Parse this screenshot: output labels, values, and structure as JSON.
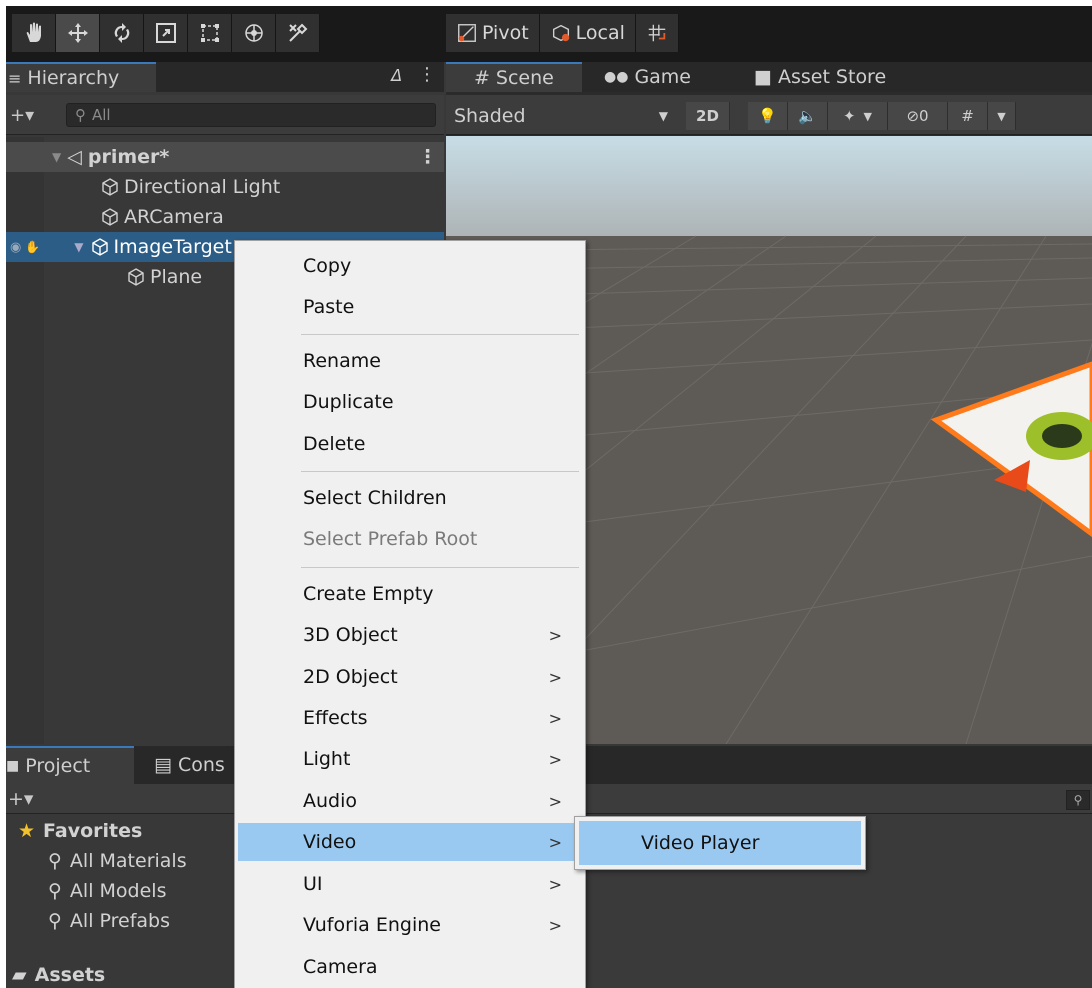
{
  "toolbar": {
    "tools": [
      "hand-tool",
      "move-tool",
      "rotate-tool",
      "scale-tool",
      "rect-tool",
      "transform-tool",
      "custom-tool"
    ],
    "pivot_label": "Pivot",
    "local_label": "Local"
  },
  "hierarchy": {
    "tab_label": "Hierarchy",
    "search_placeholder": "All",
    "items": [
      {
        "label": "primer*"
      },
      {
        "label": "Directional Light"
      },
      {
        "label": "ARCamera"
      },
      {
        "label": "ImageTarget"
      },
      {
        "label": "Plane"
      }
    ]
  },
  "scene": {
    "tabs": [
      {
        "label": "Scene"
      },
      {
        "label": "Game"
      },
      {
        "label": "Asset Store"
      }
    ],
    "shading_mode": "Shaded",
    "mode_2d": "2D",
    "hidden_count": "0"
  },
  "project": {
    "tabs": [
      {
        "label": "Project"
      },
      {
        "label": "Cons"
      }
    ],
    "favorites_label": "Favorites",
    "favorites": [
      {
        "label": "All Materials"
      },
      {
        "label": "All Models"
      },
      {
        "label": "All Prefabs"
      }
    ],
    "assets_label": "Assets"
  },
  "context_menu": {
    "items": [
      {
        "label": "Copy"
      },
      {
        "label": "Paste"
      },
      {
        "label": "Rename"
      },
      {
        "label": "Duplicate"
      },
      {
        "label": "Delete"
      },
      {
        "label": "Select Children"
      },
      {
        "label": "Select Prefab Root"
      },
      {
        "label": "Create Empty"
      },
      {
        "label": "3D Object"
      },
      {
        "label": "2D Object"
      },
      {
        "label": "Effects"
      },
      {
        "label": "Light"
      },
      {
        "label": "Audio"
      },
      {
        "label": "Video"
      },
      {
        "label": "UI"
      },
      {
        "label": "Vuforia Engine"
      },
      {
        "label": "Camera"
      }
    ],
    "submenu_arrow": ">"
  },
  "submenu": {
    "items": [
      {
        "label": "Video Player"
      }
    ]
  },
  "colors": {
    "menu_highlight": "#99c9f1",
    "selection": "#2c5d87",
    "accent_orange": "#ff7a1a"
  }
}
